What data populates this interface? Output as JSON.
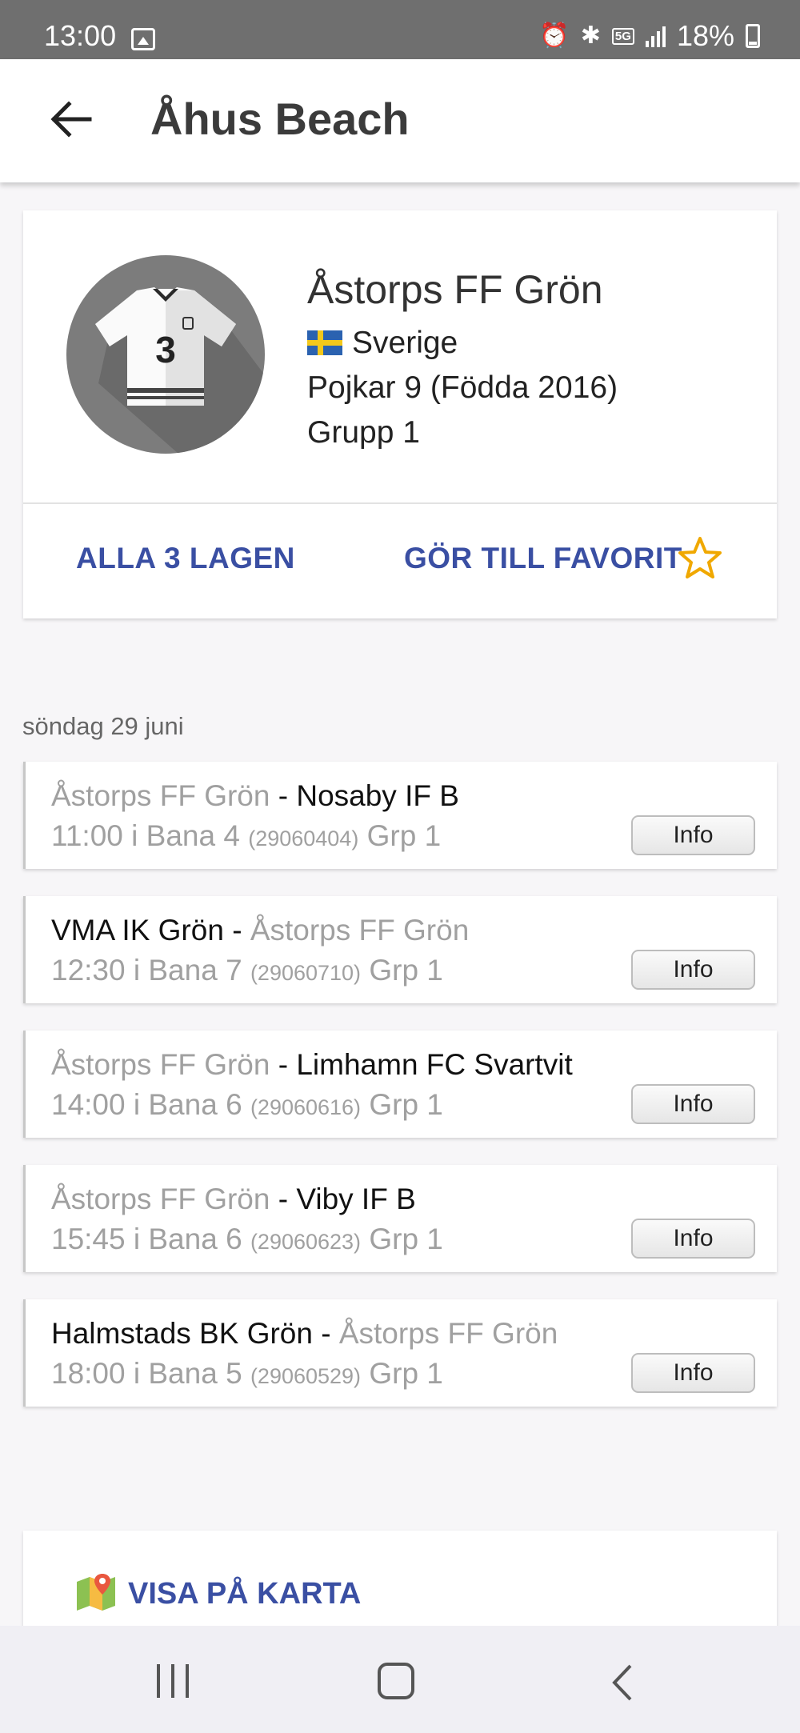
{
  "status_bar": {
    "time": "13:00",
    "network": "5G",
    "battery": "18%",
    "icons": [
      "gallery-icon",
      "alarm-icon",
      "bluetooth-icon",
      "5g-icon",
      "signal-icon",
      "battery-icon"
    ]
  },
  "app_bar": {
    "title": "Åhus Beach",
    "back_icon": "arrow-left-icon"
  },
  "team": {
    "name": "Åstorps FF Grön",
    "country": "Sverige",
    "division": "Pojkar 9 (Födda 2016)",
    "group": "Grupp 1",
    "jersey_number": "3",
    "all_teams_label": "ALLA 3 LAGEN",
    "favorite_label": "GÖR TILL FAVORIT",
    "favorite_icon": "star-outline-icon"
  },
  "schedule": {
    "date": "söndag 29 juni",
    "matches": [
      {
        "home": "Åstorps FF Grön",
        "away": "Nosaby IF B",
        "own_side": "home",
        "time": "11:00",
        "field": "Bana 4",
        "code": "(29060404)",
        "group": "Grp 1",
        "info_label": "Info"
      },
      {
        "home": "VMA IK Grön",
        "away": "Åstorps FF Grön",
        "own_side": "away",
        "time": "12:30",
        "field": "Bana 7",
        "code": "(29060710)",
        "group": "Grp 1",
        "info_label": "Info"
      },
      {
        "home": "Åstorps FF Grön",
        "away": "Limhamn FC Svartvit",
        "own_side": "home",
        "time": "14:00",
        "field": "Bana 6",
        "code": "(29060616)",
        "group": "Grp 1",
        "info_label": "Info"
      },
      {
        "home": "Åstorps FF Grön",
        "away": "Viby IF B",
        "own_side": "home",
        "time": "15:45",
        "field": "Bana 6",
        "code": "(29060623)",
        "group": "Grp 1",
        "info_label": "Info"
      },
      {
        "home": "Halmstads BK Grön",
        "away": "Åstorps FF Grön",
        "own_side": "away",
        "time": "18:00",
        "field": "Bana 5",
        "code": "(29060529)",
        "group": "Grp 1",
        "info_label": "Info"
      }
    ]
  },
  "map": {
    "label": "VISA PÅ KARTA",
    "icon": "map-icon"
  },
  "colors": {
    "accent": "#3a4fa3",
    "star": "#f0a800",
    "status_bar": "#6f6f6f"
  }
}
